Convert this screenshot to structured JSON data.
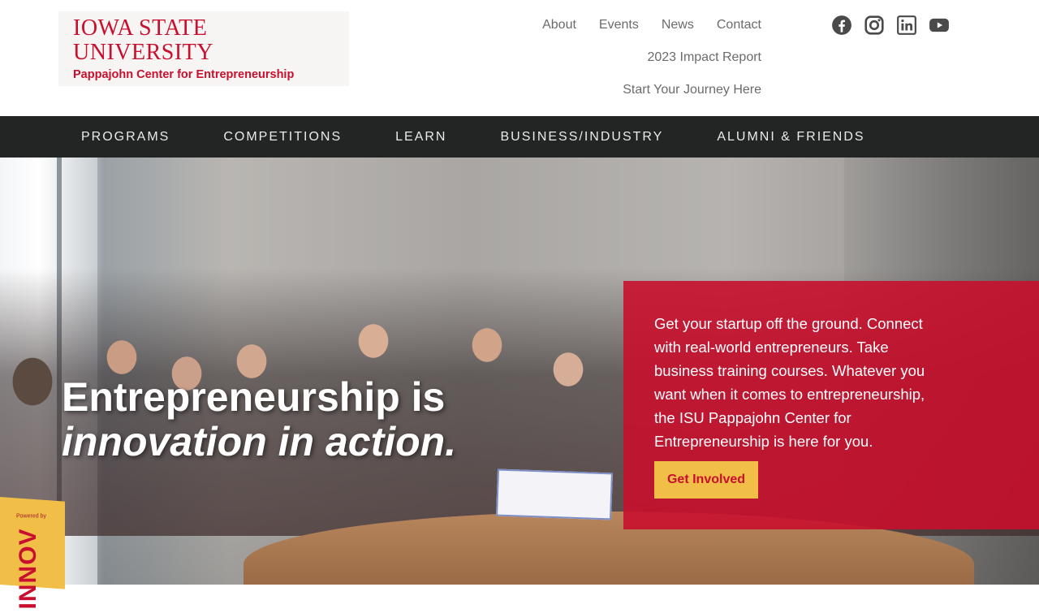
{
  "brand": {
    "line1": "Iowa State University",
    "line2": "Pappajohn Center for Entrepreneurship",
    "color": "#c8102e"
  },
  "utility_nav": {
    "items": [
      {
        "label": "About"
      },
      {
        "label": "Events"
      },
      {
        "label": "News"
      },
      {
        "label": "Contact"
      }
    ],
    "impact_report": "2023 Impact Report",
    "journey": "Start Your Journey Here"
  },
  "social": {
    "icons": [
      "facebook-icon",
      "instagram-icon",
      "linkedin-icon",
      "youtube-icon"
    ],
    "color": "#4a4a4a"
  },
  "main_nav": {
    "items": [
      {
        "label": "PROGRAMS"
      },
      {
        "label": "COMPETITIONS"
      },
      {
        "label": "LEARN"
      },
      {
        "label": "BUSINESS/INDUSTRY"
      },
      {
        "label": "ALUMNI & FRIENDS"
      }
    ],
    "background": "#232525"
  },
  "hero": {
    "title_line1": "Entrepreneurship is",
    "title_line2": "innovation in action.",
    "cta_text": "Get your startup off the ground. Connect with real-world entrepreneurs. Take business training courses. Whatever you want when it comes to entrepreneurship, the ISU Pappajohn Center for Entrepreneurship is here for you.",
    "cta_button": "Get Involved",
    "cta_box_color": "#c8102e",
    "cta_button_color": "#f1be48"
  },
  "badge": {
    "powered_by": "Powered by",
    "name": "INNOV"
  }
}
